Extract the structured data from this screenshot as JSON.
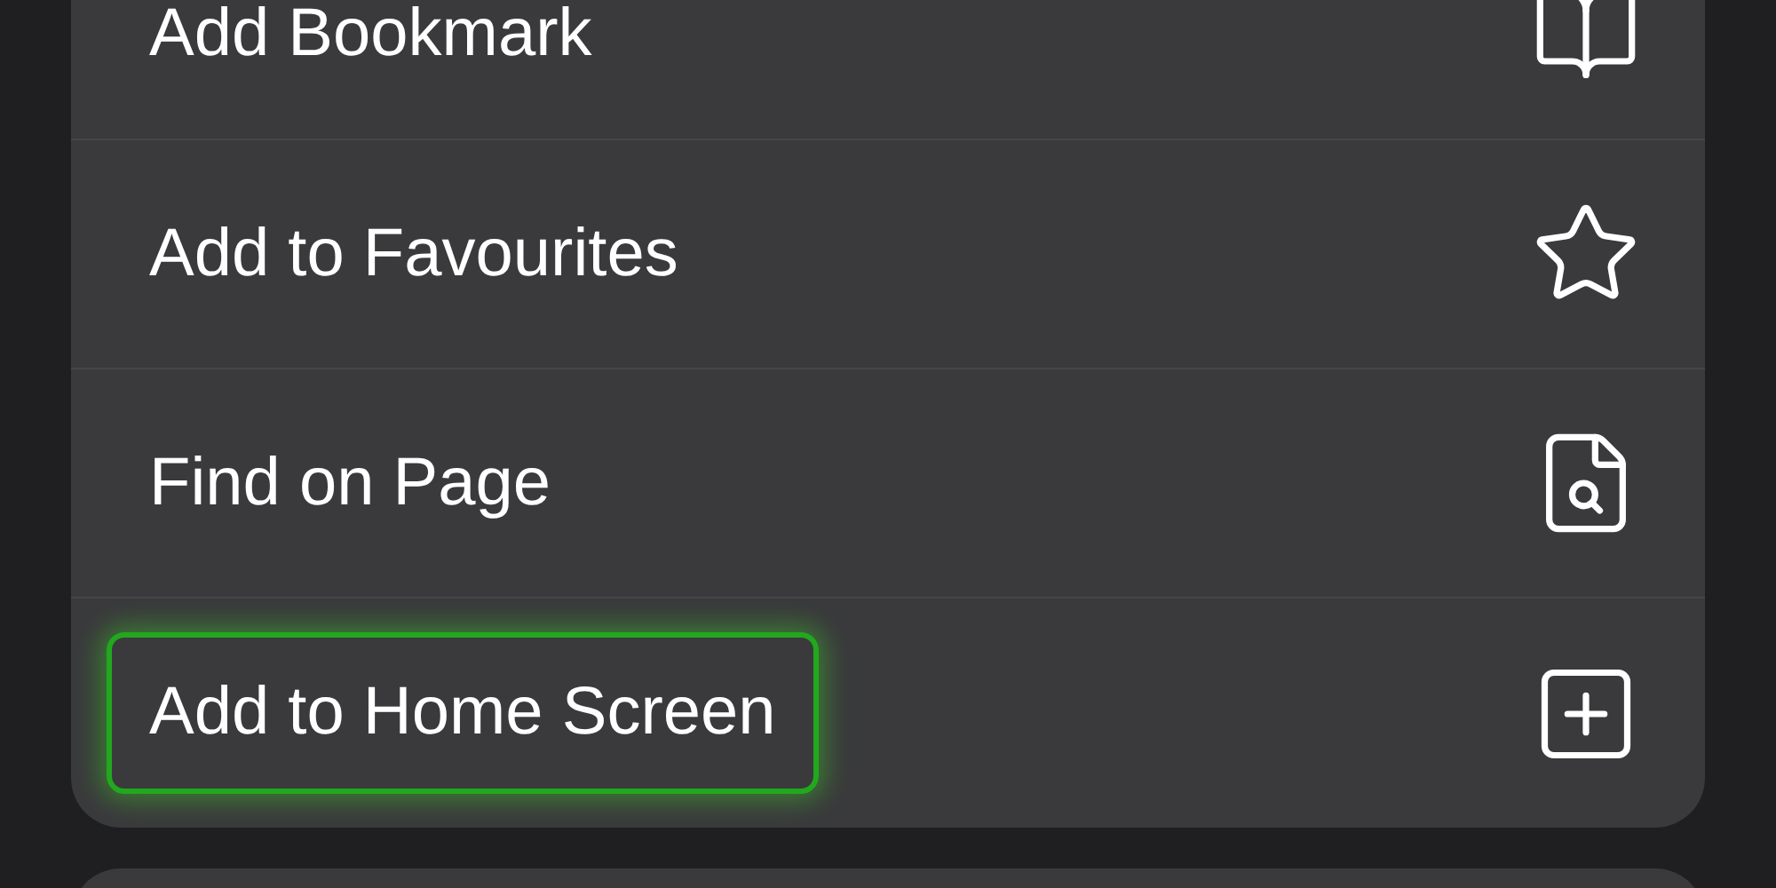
{
  "menu": {
    "items": [
      {
        "label": "Add Bookmark",
        "highlighted": false
      },
      {
        "label": "Add to Favourites",
        "highlighted": false
      },
      {
        "label": "Find on Page",
        "highlighted": false
      },
      {
        "label": "Add to Home Screen",
        "highlighted": true
      }
    ]
  }
}
